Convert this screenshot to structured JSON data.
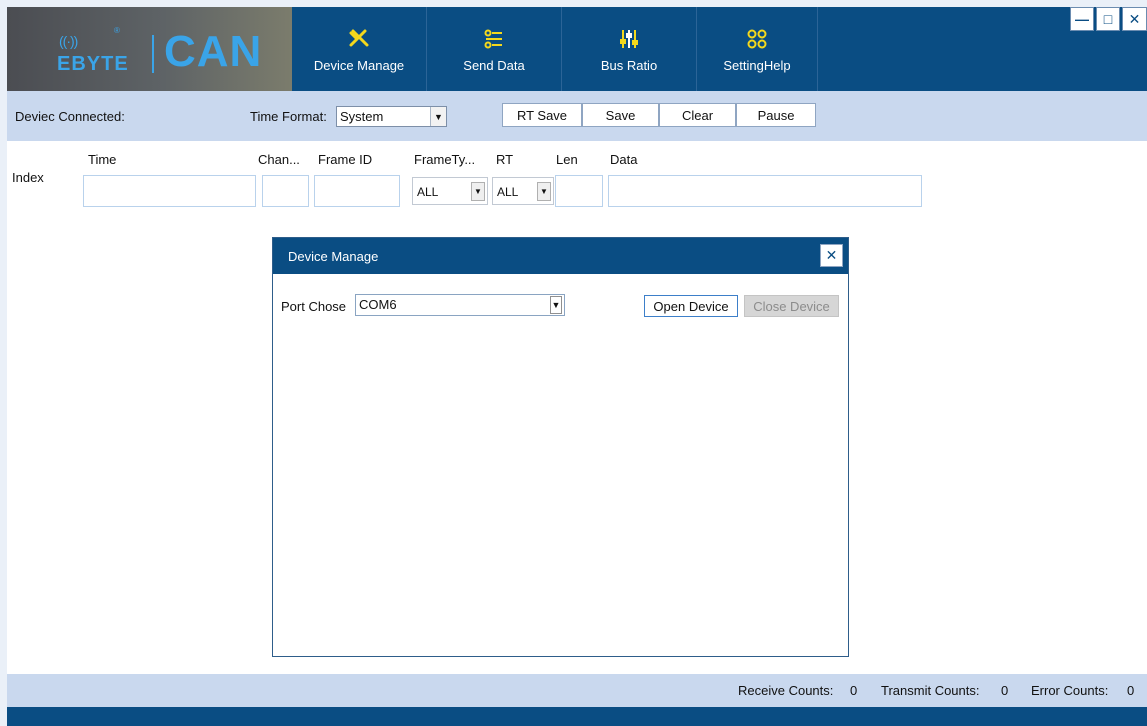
{
  "header": {
    "logo_brand": "EBYTE",
    "logo_signal": "((·))",
    "logo_reg": "®",
    "logo_product": "CAN",
    "nav": [
      {
        "label": "Device Manage",
        "icon": "tools-icon",
        "glyph": "✕"
      },
      {
        "label": "Send Data",
        "icon": "list-icon",
        "glyph": "☰"
      },
      {
        "label": "Bus Ratio",
        "icon": "sliders-icon",
        "glyph": "⫼"
      },
      {
        "label": "SettingHelp",
        "icon": "settings-help-icon",
        "glyph": "∞"
      }
    ],
    "window_controls": {
      "minimize": "—",
      "maximize": "□",
      "close": "✕"
    }
  },
  "toolbar": {
    "device_connected_label": "Deviec Connected:",
    "time_format_label": "Time Format:",
    "time_format_value": "System",
    "buttons": [
      "RT Save",
      "Save",
      "Clear",
      "Pause"
    ]
  },
  "filters": {
    "index_label": "Index",
    "columns": [
      "Time",
      "Chan...",
      "Frame ID",
      "FrameTy...",
      "RT",
      "Len",
      "Data"
    ],
    "frame_type_value": "ALL",
    "rt_value": "ALL"
  },
  "dialog": {
    "title": "Device Manage",
    "close_glyph": "✕",
    "port_label": "Port Chose",
    "port_value": "COM6",
    "open_button": "Open Device",
    "close_button": "Close Device"
  },
  "status": {
    "receive_label": "Receive Counts:",
    "receive_value": "0",
    "transmit_label": "Transmit Counts:",
    "transmit_value": "0",
    "error_label": "Error Counts:",
    "error_value": "0"
  },
  "colors": {
    "header_blue": "#0a4d83",
    "toolbar_light": "#c9d8ee",
    "accent_yellow": "#f4d81c",
    "logo_blue": "#3aa4e8"
  }
}
